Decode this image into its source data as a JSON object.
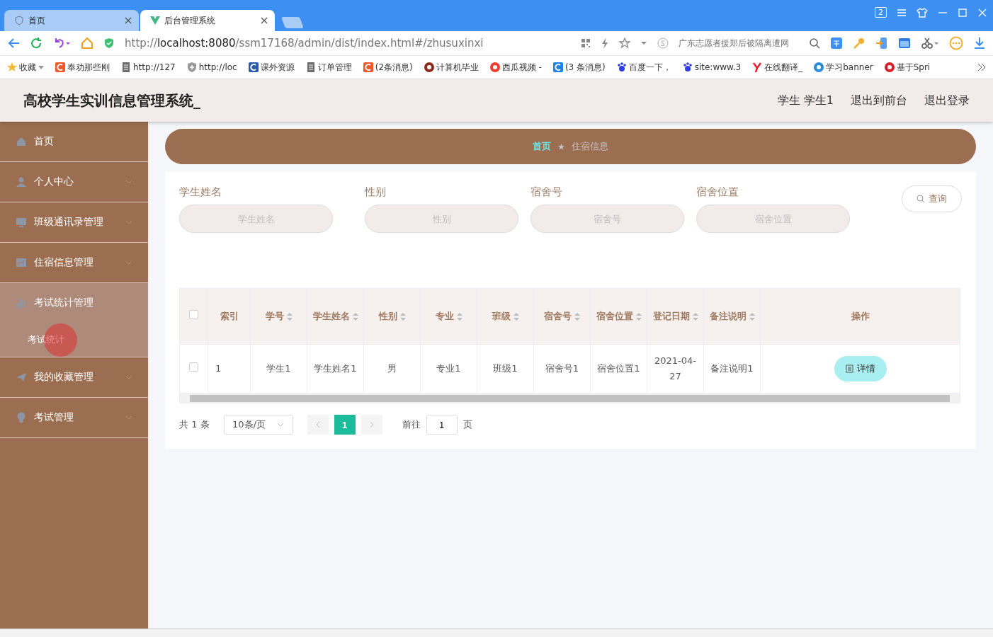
{
  "browser": {
    "tabs": [
      {
        "title": "首页",
        "selected": false
      },
      {
        "title": "后台管理系统",
        "selected": true
      }
    ],
    "window_badge": "2",
    "url": {
      "scheme": "http://",
      "host": "localhost:8080",
      "path": "/ssm17168/admin/dist/index.html#/zhusuxinxi"
    },
    "search_placeholder": "广东志愿者援郑后被隔离遭网",
    "bookmarks": [
      {
        "label": "收藏",
        "kind": "star",
        "color": "#f5b82e"
      },
      {
        "label": "奉劝那些刚",
        "kind": "site",
        "color": "#f0582c"
      },
      {
        "label": "http://127",
        "kind": "page",
        "color": "#6b6b6b"
      },
      {
        "label": "http://loc",
        "kind": "shield",
        "color": "#9a9a9a"
      },
      {
        "label": "课外资源",
        "kind": "site",
        "color": "#2a5aa8"
      },
      {
        "label": "订单管理",
        "kind": "page",
        "color": "#6b6b6b"
      },
      {
        "label": "(2条消息)",
        "kind": "site",
        "color": "#f0582c"
      },
      {
        "label": "计算机毕业",
        "kind": "round",
        "color": "#8c2a1c"
      },
      {
        "label": "西瓜视频 -",
        "kind": "round",
        "color": "#f03c2e"
      },
      {
        "label": "(3 条消息)",
        "kind": "site",
        "color": "#1e80e8"
      },
      {
        "label": "百度一下，",
        "kind": "paw",
        "color": "#2f3ee0"
      },
      {
        "label": "site:www.3",
        "kind": "paw",
        "color": "#2f3ee0"
      },
      {
        "label": "在线翻译_",
        "kind": "y",
        "color": "#e0202a"
      },
      {
        "label": "学习banner",
        "kind": "round",
        "color": "#2a8ad8"
      },
      {
        "label": "基于Spri",
        "kind": "round",
        "color": "#d8202a"
      }
    ]
  },
  "app": {
    "title": "高校学生实训信息管理系统_",
    "user": "学生 学生1",
    "links": [
      "退出到前台",
      "退出登录"
    ],
    "sidebar": [
      {
        "label": "首页"
      },
      {
        "label": "个人中心",
        "expanded": false
      },
      {
        "label": "班级通讯录管理",
        "expanded": false
      },
      {
        "label": "住宿信息管理",
        "expanded": false
      },
      {
        "label": "考试统计管理",
        "expanded": true,
        "children": [
          {
            "label": "考试统计"
          }
        ]
      },
      {
        "label": "我的收藏管理",
        "expanded": false
      },
      {
        "label": "考试管理",
        "expanded": false
      }
    ],
    "breadcrumb": [
      "首页",
      "住宿信息"
    ],
    "filters": [
      {
        "label": "学生姓名",
        "placeholder": "学生姓名"
      },
      {
        "label": "性别",
        "placeholder": "性别"
      },
      {
        "label": "宿舍号",
        "placeholder": "宿舍号"
      },
      {
        "label": "宿舍位置",
        "placeholder": "宿舍位置"
      }
    ],
    "query_button": "查询",
    "table": {
      "all_checked": false,
      "columns": [
        {
          "label": "索引",
          "sortable": false
        },
        {
          "label": "学号",
          "sortable": true
        },
        {
          "label": "学生姓名",
          "sortable": true
        },
        {
          "label": "性别",
          "sortable": true
        },
        {
          "label": "专业",
          "sortable": true
        },
        {
          "label": "班级",
          "sortable": true
        },
        {
          "label": "宿舍号",
          "sortable": true
        },
        {
          "label": "宿舍位置",
          "sortable": true
        },
        {
          "label": "登记日期",
          "sortable": true
        },
        {
          "label": "备注说明",
          "sortable": true
        },
        {
          "label": "操作",
          "sortable": false
        }
      ],
      "rows": [
        {
          "checked": false,
          "cells": [
            "1",
            "学生1",
            "学生姓名1",
            "男",
            "专业1",
            "班级1",
            "宿舍号1",
            "宿舍位置1",
            "2021-04-27",
            "备注说明1"
          ],
          "action": "详情"
        }
      ]
    },
    "pagination": {
      "total": "共 1 条",
      "page_size": "10条/页",
      "pages": [
        {
          "label": "1",
          "selected": true
        }
      ],
      "goto_label": "前往",
      "goto_value": "1",
      "goto_suffix": "页"
    }
  }
}
